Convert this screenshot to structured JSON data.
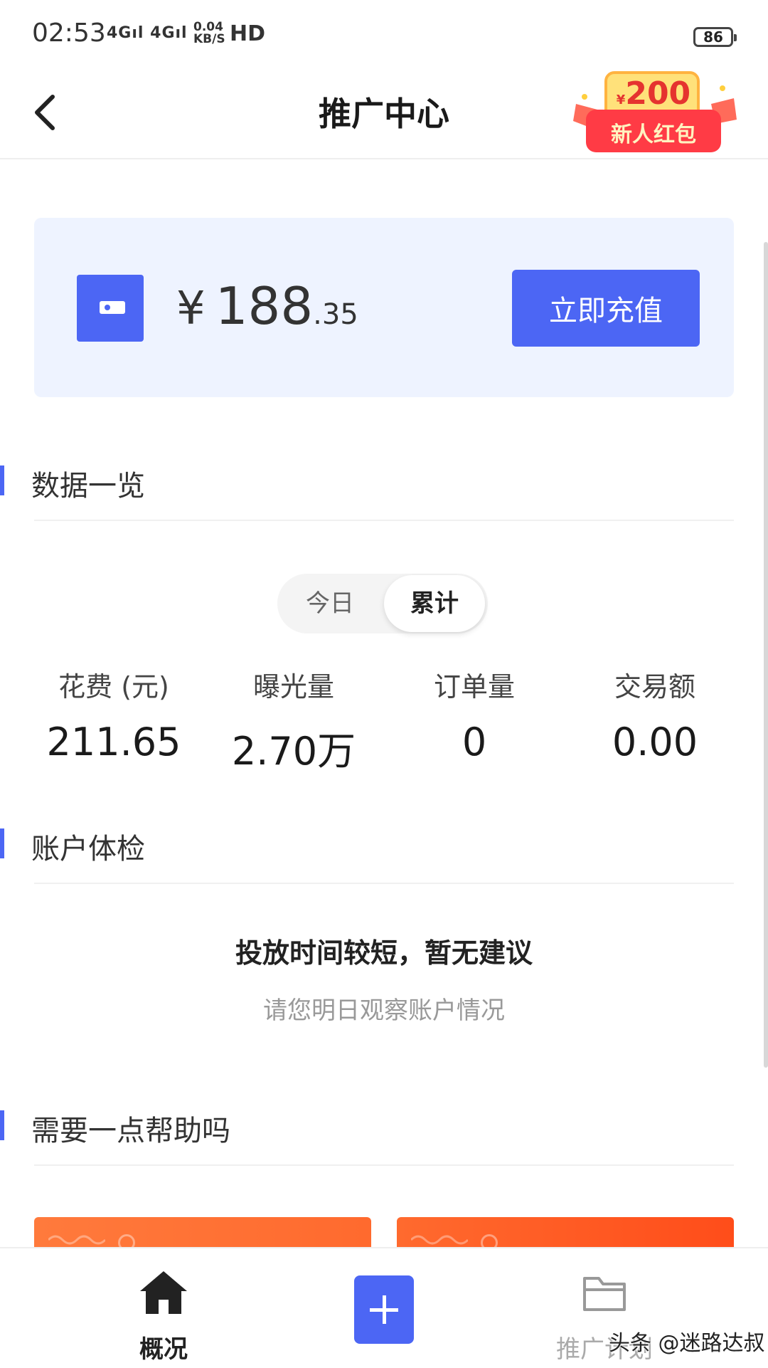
{
  "status_bar": {
    "time": "02:53",
    "signal_1": "4G",
    "signal_2": "4G",
    "net_speed_value": "0.04",
    "net_speed_unit": "KB/S",
    "hd": "HD",
    "battery": "86"
  },
  "header": {
    "title": "推广中心",
    "promo_amount": "200",
    "promo_currency": "¥",
    "promo_label": "新人红包"
  },
  "balance": {
    "currency": "¥",
    "integer": "188",
    "decimal": ".35",
    "recharge_label": "立即充值"
  },
  "overview": {
    "title": "数据一览",
    "tabs": [
      "今日",
      "累计"
    ],
    "selected_tab": "累计",
    "stats": [
      {
        "label": "花费 (元)",
        "value": "211.65"
      },
      {
        "label": "曝光量",
        "value": "2.70万"
      },
      {
        "label": "订单量",
        "value": "0"
      },
      {
        "label": "交易额",
        "value": "0.00"
      }
    ]
  },
  "account_check": {
    "title": "账户体检",
    "message": "投放时间较短，暂无建议",
    "sub_message": "请您明日观察账户情况"
  },
  "help": {
    "title": "需要一点帮助吗"
  },
  "bottom_nav": {
    "home_label": "概况",
    "plan_label": "推广计划"
  },
  "watermark": "头条 @迷路达叔",
  "colors": {
    "accent": "#4c66f4",
    "card_bg": "#eef3ff",
    "banner_orange": "#ff6a2e"
  }
}
